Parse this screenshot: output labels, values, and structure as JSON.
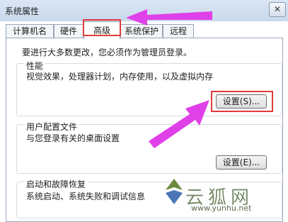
{
  "window": {
    "title": "系统属性",
    "close": "✕"
  },
  "tabs": [
    {
      "label": "计算机名"
    },
    {
      "label": "硬件"
    },
    {
      "label": "高级"
    },
    {
      "label": "系统保护"
    },
    {
      "label": "远程"
    }
  ],
  "notice": "要进行大多数更改，您必须作为管理员登录。",
  "performance": {
    "title": "性能",
    "desc": "视觉效果，处理器计划，内存使用，以及虚拟内存",
    "button": "设置(S)..."
  },
  "profiles": {
    "title": "用户配置文件",
    "desc": "与您登录有关的桌面设置",
    "button": "设置(E)..."
  },
  "startup": {
    "title": "启动和故障恢复",
    "desc": "系统启动、系统失败和调试信息"
  },
  "watermark": {
    "text": "云狐网",
    "url": "www.yunhu.net"
  },
  "colors": {
    "arrow": "#e040e8",
    "highlight": "#e13b3b"
  }
}
